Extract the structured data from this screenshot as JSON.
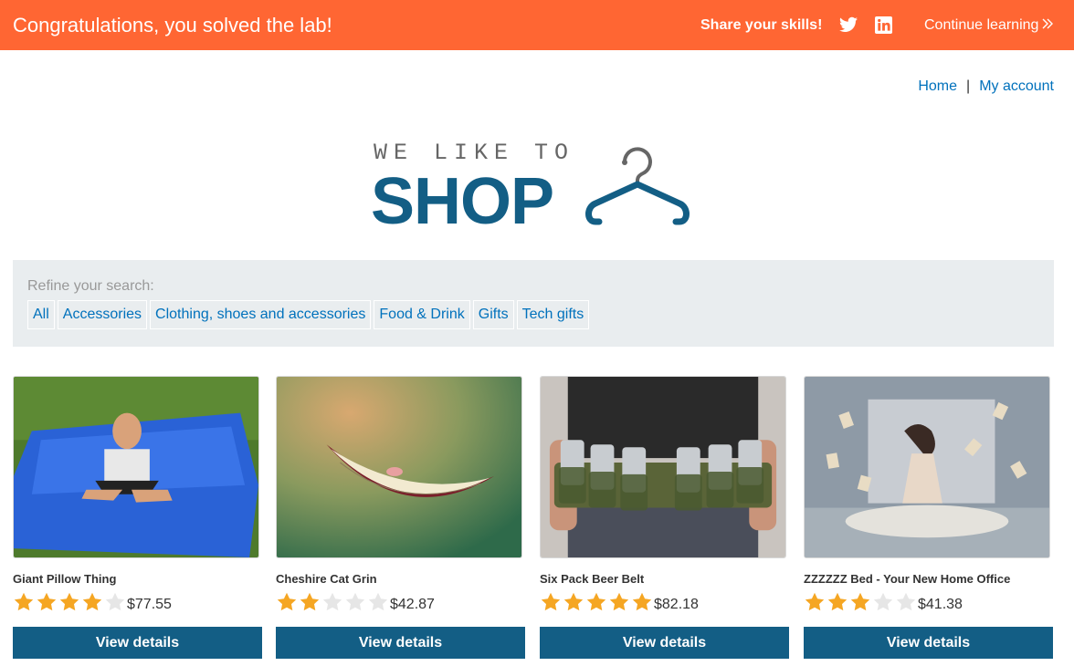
{
  "banner": {
    "title": "Congratulations, you solved the lab!",
    "share_label": "Share your skills!",
    "continue_label": "Continue learning",
    "color": "#ff6633"
  },
  "nav": {
    "home": "Home",
    "separator": "|",
    "account": "My account"
  },
  "logo": {
    "line1": "WE LIKE TO",
    "line2": "SHOP",
    "color": "#135e85"
  },
  "refine": {
    "label": "Refine your search:",
    "filters": [
      "All",
      "Accessories",
      "Clothing, shoes and accessories",
      "Food & Drink",
      "Gifts",
      "Tech gifts"
    ]
  },
  "products": [
    {
      "name": "Giant Pillow Thing",
      "price": "$77.55",
      "rating": 4,
      "button": "View details"
    },
    {
      "name": "Cheshire Cat Grin",
      "price": "$42.87",
      "rating": 2,
      "button": "View details"
    },
    {
      "name": "Six Pack Beer Belt",
      "price": "$82.18",
      "rating": 5,
      "button": "View details"
    },
    {
      "name": "ZZZZZZ Bed - Your New Home Office",
      "price": "$41.38",
      "rating": 3,
      "button": "View details"
    }
  ],
  "colors": {
    "accent": "#135e85",
    "link": "#0071bc",
    "star_on": "#f5a623",
    "star_off": "#e6e6e6"
  }
}
